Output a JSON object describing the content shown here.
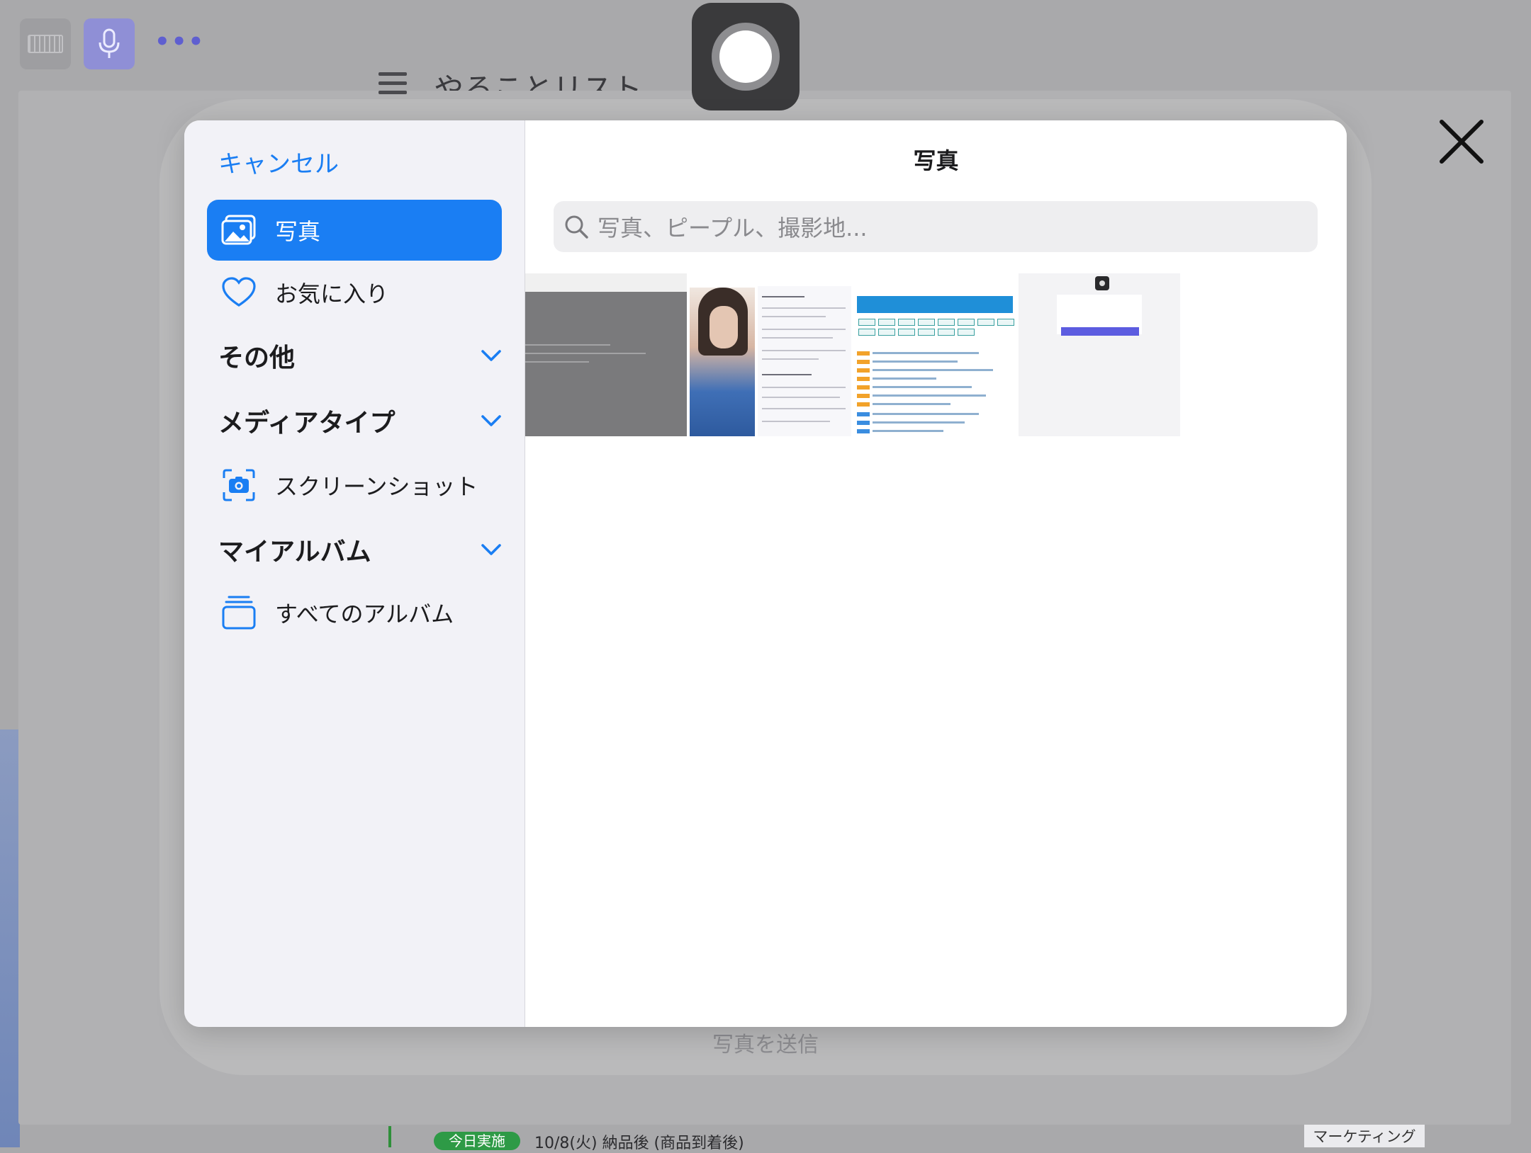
{
  "background": {
    "todo_title": "やることリスト",
    "send_photo_label": "写真を送信",
    "task_badge": "今日実施",
    "task_date": "10/8(火) 納品後 (商品到着後)",
    "task_tag": "マーケティング",
    "more_dots": "•••"
  },
  "picker": {
    "cancel_label": "キャンセル",
    "title": "写真",
    "search_placeholder": "写真、ピープル、撮影地...",
    "sidebar": {
      "photos_label": "写真",
      "favorites_label": "お気に入り",
      "other_section": "その他",
      "media_types_section": "メディアタイプ",
      "screenshots_label": "スクリーンショット",
      "my_albums_section": "マイアルバム",
      "all_albums_label": "すべてのアルバム"
    }
  },
  "colors": {
    "accent": "#1a7ef3",
    "sidebar_bg": "#f2f2f7",
    "overlay_bg": "#a9a9ab"
  }
}
